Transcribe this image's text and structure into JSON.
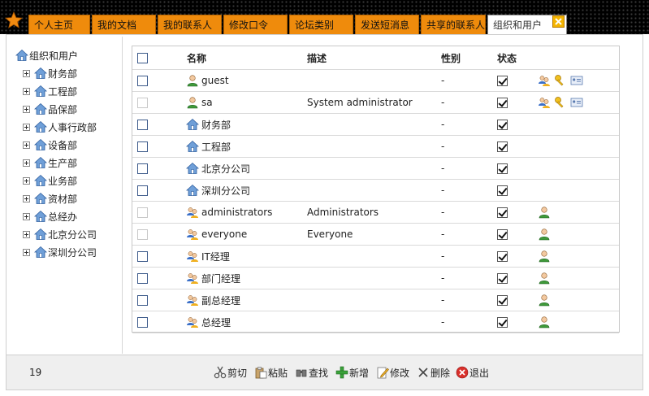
{
  "tabs": [
    {
      "label": "个人主页",
      "active": false
    },
    {
      "label": "我的文档",
      "active": false
    },
    {
      "label": "我的联系人",
      "active": false
    },
    {
      "label": "修改口令",
      "active": false
    },
    {
      "label": "论坛类别",
      "active": false
    },
    {
      "label": "发送短消息",
      "active": false
    },
    {
      "label": "共享的联系人",
      "active": false
    },
    {
      "label": "组织和用户",
      "active": true
    }
  ],
  "tree": {
    "root": "组织和用户",
    "items": [
      "财务部",
      "工程部",
      "品保部",
      "人事行政部",
      "设备部",
      "生产部",
      "业务部",
      "资材部",
      "总经办",
      "北京分公司",
      "深圳分公司"
    ]
  },
  "grid": {
    "headers": {
      "name": "名称",
      "desc": "描述",
      "gender": "性别",
      "status": "状态"
    },
    "rows": [
      {
        "name": "guest",
        "desc": "",
        "gender": "-",
        "type": "user",
        "checkbox_enabled": true,
        "actions": [
          "group-icon",
          "key-icon",
          "card-icon"
        ]
      },
      {
        "name": "sa",
        "desc": "System administrator",
        "gender": "-",
        "type": "user",
        "checkbox_enabled": false,
        "actions": [
          "group-icon",
          "key-icon",
          "card-icon"
        ]
      },
      {
        "name": "财务部",
        "desc": "",
        "gender": "-",
        "type": "org",
        "checkbox_enabled": true,
        "actions": []
      },
      {
        "name": "工程部",
        "desc": "",
        "gender": "-",
        "type": "org",
        "checkbox_enabled": true,
        "actions": []
      },
      {
        "name": "北京分公司",
        "desc": "",
        "gender": "-",
        "type": "org",
        "checkbox_enabled": true,
        "actions": []
      },
      {
        "name": "深圳分公司",
        "desc": "",
        "gender": "-",
        "type": "org",
        "checkbox_enabled": true,
        "actions": []
      },
      {
        "name": "administrators",
        "desc": "Administrators",
        "gender": "-",
        "type": "group",
        "checkbox_enabled": false,
        "actions": [
          "user-icon"
        ]
      },
      {
        "name": "everyone",
        "desc": "Everyone",
        "gender": "-",
        "type": "group",
        "checkbox_enabled": false,
        "actions": [
          "user-icon"
        ]
      },
      {
        "name": "IT经理",
        "desc": "",
        "gender": "-",
        "type": "group",
        "checkbox_enabled": true,
        "actions": [
          "user-icon"
        ]
      },
      {
        "name": "部门经理",
        "desc": "",
        "gender": "-",
        "type": "group",
        "checkbox_enabled": true,
        "actions": [
          "user-icon"
        ]
      },
      {
        "name": "副总经理",
        "desc": "",
        "gender": "-",
        "type": "group",
        "checkbox_enabled": true,
        "actions": [
          "user-icon"
        ]
      },
      {
        "name": "总经理",
        "desc": "",
        "gender": "-",
        "type": "group",
        "checkbox_enabled": true,
        "actions": [
          "user-icon"
        ]
      }
    ]
  },
  "footer": {
    "count": "19",
    "buttons": [
      {
        "label": "剪切",
        "icon": "scissors-icon"
      },
      {
        "label": "粘贴",
        "icon": "paste-icon"
      },
      {
        "label": "查找",
        "icon": "find-icon"
      },
      {
        "label": "新增",
        "icon": "add-icon"
      },
      {
        "label": "修改",
        "icon": "edit-icon"
      },
      {
        "label": "删除",
        "icon": "delete-icon"
      },
      {
        "label": "退出",
        "icon": "exit-icon"
      }
    ]
  }
}
